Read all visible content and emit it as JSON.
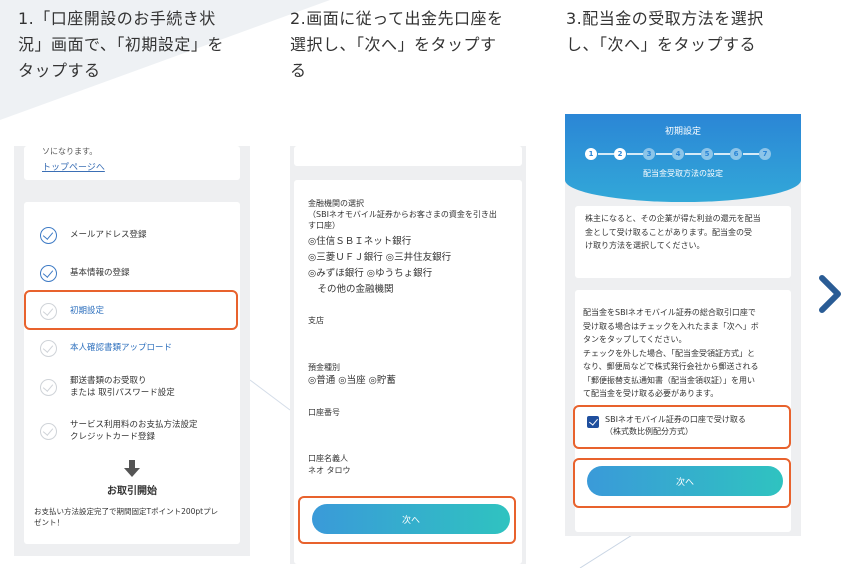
{
  "captions": {
    "step1": "1.「口座開設のお手続き状\n況」画面で、「初期設定」を\nタップする",
    "step2": "2.画面に従って出金先口座を\n選択し、「次へ」をタップす\nる",
    "step3": "3.配当金の受取方法を選択\nし、「次へ」をタップする"
  },
  "screen1": {
    "top_text": "ソになります。",
    "top_link": "トップページへ",
    "steps": [
      {
        "label": "メールアドレス登録",
        "done": true
      },
      {
        "label": "基本情報の登録",
        "done": true
      },
      {
        "label": "初期設定",
        "done": false
      },
      {
        "label": "本人確認書類アップロード",
        "done": false
      },
      {
        "label": "郵送書類のお受取り\nまたは 取引パスワード設定",
        "done": false
      },
      {
        "label": "サービス利用料のお支払方法設定\nクレジットカード登録",
        "done": false
      }
    ],
    "start_label": "お取引開始",
    "note": "お支払い方法設定完了で期間固定Tポイント200ptプレ\nゼント！"
  },
  "screen2": {
    "bank_heading": "金融機関の選択\n（SBIネオモバイル証券からお客さまの資金を引き出\nす口座）",
    "bank_options": "◎住信ＳＢＩネット銀行\n◎三菱ＵＦＪ銀行 ◎三井住友銀行\n◎みずほ銀行 ◎ゆうちょ銀行\n　その他の金融機関",
    "branch_label": "支店",
    "account_type_label": "預金種別",
    "account_type_options": "◎普通 ◎当座 ◎貯蓄",
    "account_number_label": "口座番号",
    "holder_label": "口座名義人",
    "holder_value": "ネオ タロウ",
    "next_button": "次へ"
  },
  "screen3": {
    "title": "初期設定",
    "steps": [
      "1",
      "2",
      "3",
      "4",
      "5",
      "6",
      "7"
    ],
    "current_step": 2,
    "subtitle": "配当金受取方法の設定",
    "intro": "株主になると、その企業が得た利益の還元を配当\n金として受け取ることがあります。配当金の受\nけ取り方法を選択してください。",
    "body": "配当金をSBIネオモバイル証券の総合取引口座で\n受け取る場合はチェックを入れたまま「次へ」ボ\nタンをタップしてください。\nチェックを外した場合、「配当金受領証方式」と\nなり、郵便局などで株式発行会社から郵送される\n「郵便振替支払通知書（配当金領収証）」を用い\nて配当金を受け取る必要があります。",
    "checkbox_label": "SBIネオモバイル証券の口座で受け取る\n（株式数比例配分方式）",
    "checkbox_checked": true,
    "next_button": "次へ"
  },
  "colors": {
    "highlight": "#e8622d",
    "button_gradient_start": "#3a9ad9",
    "button_gradient_end": "#2fc3c0",
    "arrow": "#2a5c95"
  },
  "icons": {
    "next_arrow": "chevron-right-icon",
    "down_arrow": "arrow-down-icon"
  }
}
